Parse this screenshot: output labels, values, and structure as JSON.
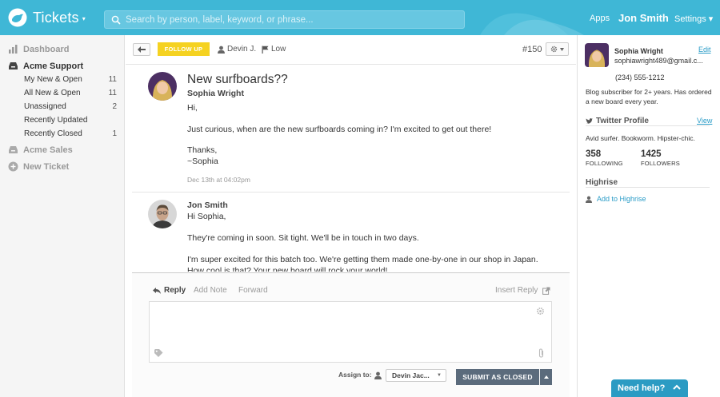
{
  "header": {
    "app_title": "Tickets",
    "app_caret": "▾",
    "search_placeholder": "Search by person, label, keyword, or phrase...",
    "nav_apps": "Apps",
    "user_name": "Jon Smith",
    "nav_settings": "Settings ▾"
  },
  "sidebar": {
    "dashboard": "Dashboard",
    "group1": {
      "title": "Acme Support",
      "items": [
        {
          "label": "My New & Open",
          "count": "11"
        },
        {
          "label": "All New & Open",
          "count": "11"
        },
        {
          "label": "Unassigned",
          "count": "2"
        },
        {
          "label": "Recently Updated",
          "count": ""
        },
        {
          "label": "Recently Closed",
          "count": "1"
        }
      ]
    },
    "group2": "Acme Sales",
    "new_ticket": "New Ticket"
  },
  "toolbar": {
    "follow_up": "FOLLOW UP",
    "assignee": "Devin J.",
    "priority": "Low",
    "ticket_number": "#150"
  },
  "ticket": {
    "subject": "New surfboards??",
    "messages": [
      {
        "author": "Sophia Wright",
        "lines": [
          "Hi,",
          "Just curious, when are the new surfboards coming in? I'm excited to get out there!",
          "Thanks,",
          "~Sophia"
        ],
        "timestamp": "Dec 13th at 04:02pm"
      },
      {
        "author": "Jon Smith",
        "lines": [
          "Hi Sophia,",
          "They're coming in soon. Sit tight. We'll be in touch in two days.",
          "I'm super excited for this batch too. We're getting them made one-by-one in our shop in Japan.",
          "How cool is that? Your new board will rock your world!"
        ]
      }
    ]
  },
  "reply": {
    "tabs": [
      "Reply",
      "Add Note",
      "Forward"
    ],
    "insert_reply": "Insert Reply",
    "assign_label": "Assign to:",
    "assign_value": "Devin Jac...",
    "submit": "SUBMIT AS CLOSED"
  },
  "customer": {
    "name": "Sophia Wright",
    "email": "sophiawright489@gmail.c...",
    "edit": "Edit",
    "phone": "(234) 555-1212",
    "bio_lines": [
      "Blog subscriber for 2+ years. Has ordered",
      "a new board every year."
    ],
    "twitter": {
      "title": "Twitter Profile",
      "view": "View",
      "bio": "Avid surfer. Bookworm. Hipster-chic.",
      "following": "358",
      "following_label": "FOLLOWING",
      "followers": "1425",
      "followers_label": "FOLLOWERS"
    },
    "highrise": {
      "title": "Highrise",
      "add": "Add to Highrise"
    }
  },
  "help": {
    "label": "Need help?"
  },
  "colors": {
    "header": "#3fb7d6",
    "follow_up": "#f5d221",
    "submit": "#5b6b7c",
    "link": "#2a9cc7",
    "help": "#2b9bc3"
  }
}
